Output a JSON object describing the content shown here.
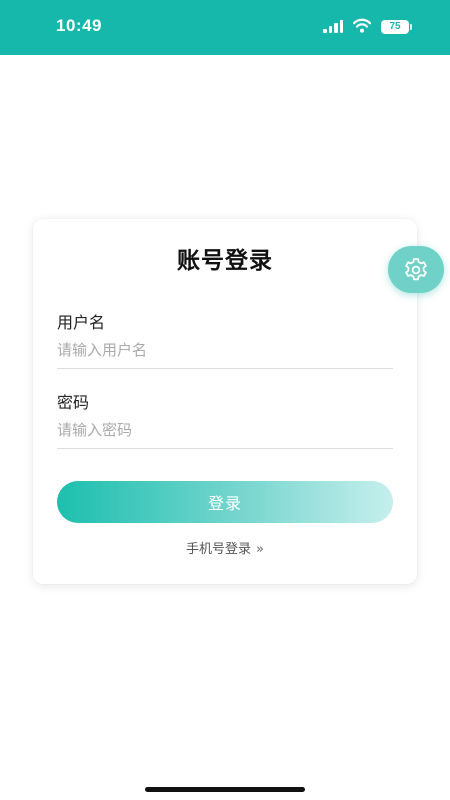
{
  "status_bar": {
    "time": "10:49",
    "battery": "75",
    "background_color": "#17b8ac"
  },
  "login_card": {
    "title": "账号登录",
    "username": {
      "label": "用户名",
      "placeholder": "请输入用户名",
      "value": ""
    },
    "password": {
      "label": "密码",
      "placeholder": "请输入密码",
      "value": ""
    },
    "login_button_label": "登录",
    "phone_login_label": "手机号登录",
    "phone_login_icon": "double-chevron-right-icon"
  },
  "settings_button": {
    "icon": "gear-icon"
  },
  "colors": {
    "accent": "#17b8ac",
    "button_gradient_start": "#1cbfae",
    "button_gradient_end": "#c6efed"
  }
}
